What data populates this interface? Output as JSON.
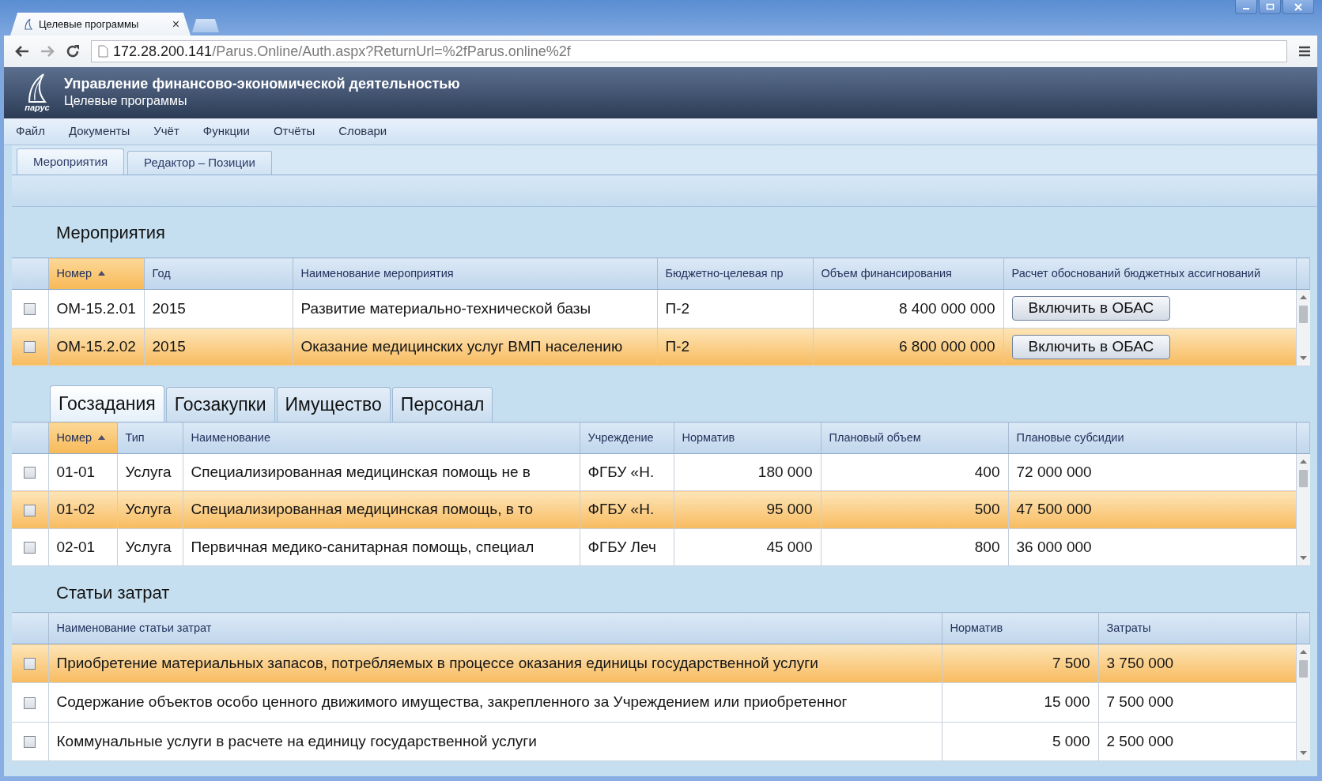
{
  "browser": {
    "tab_title": "Целевые программы",
    "tab_close": "×",
    "url_host": "172.28.200.141",
    "url_path": "/Parus.Online/Auth.aspx?ReturnUrl=%2fParus.online%2f"
  },
  "app": {
    "logo_text": "парус",
    "title": "Управление финансово-экономической деятельностью",
    "subtitle": "Целевые программы"
  },
  "menu": [
    "Файл",
    "Документы",
    "Учёт",
    "Функции",
    "Отчёты",
    "Словари"
  ],
  "tabs": [
    {
      "label": "Мероприятия",
      "selected": true
    },
    {
      "label": "Редактор – Позиции",
      "selected": false
    }
  ],
  "events": {
    "title": "Мероприятия",
    "columns": [
      {
        "label": "Номер",
        "sorted": true
      },
      {
        "label": "Год",
        "sorted": false
      },
      {
        "label": "Наименование мероприятия",
        "sorted": false
      },
      {
        "label": "Бюджетно-целевая пр",
        "sorted": false
      },
      {
        "label": "Объем финансирования",
        "sorted": false
      },
      {
        "label": "Расчет обоснований бюджетных ассигнований",
        "sorted": false
      }
    ],
    "rows": [
      {
        "selected": false,
        "checked": false,
        "cells": [
          "ОМ-15.2.01",
          "2015",
          "Развитие материально-технической базы",
          "П-2",
          "8 400 000 000"
        ],
        "button": "Включить в ОБАС"
      },
      {
        "selected": true,
        "checked": false,
        "cells": [
          "ОМ-15.2.02",
          "2015",
          "Оказание медицинских услуг ВМП населению",
          "П-2",
          "6 800 000 000"
        ],
        "button": "Включить в ОБАС"
      }
    ]
  },
  "detail_tabs": [
    {
      "label": "Госзадания",
      "selected": true
    },
    {
      "label": "Госзакупки",
      "selected": false
    },
    {
      "label": "Имущество",
      "selected": false
    },
    {
      "label": "Персонал",
      "selected": false
    }
  ],
  "tasks": {
    "columns": [
      {
        "label": "Номер",
        "sorted": true
      },
      {
        "label": "Тип",
        "sorted": false
      },
      {
        "label": "Наименование",
        "sorted": false
      },
      {
        "label": "Учреждение",
        "sorted": false
      },
      {
        "label": "Норматив",
        "sorted": false
      },
      {
        "label": "Плановый объем",
        "sorted": false
      },
      {
        "label": "Плановые субсидии",
        "sorted": false
      }
    ],
    "rows": [
      {
        "selected": false,
        "checked": false,
        "cells": [
          "01-01",
          "Услуга",
          "Специализированная медицинская помощь не в",
          "ФГБУ «Н.",
          "180 000",
          "400",
          "72 000 000"
        ]
      },
      {
        "selected": true,
        "checked": false,
        "cells": [
          "01-02",
          "Услуга",
          "Специализированная медицинская помощь, в то",
          "ФГБУ «Н.",
          "95 000",
          "500",
          "47 500 000"
        ]
      },
      {
        "selected": false,
        "checked": false,
        "cells": [
          "02-01",
          "Услуга",
          "Первичная медико-санитарная помощь, специал",
          "ФГБУ Леч",
          "45 000",
          "800",
          "36 000 000"
        ]
      }
    ]
  },
  "costs": {
    "title": "Статьи затрат",
    "columns": [
      {
        "label": "Наименование статьи затрат",
        "sorted": false
      },
      {
        "label": "Норматив",
        "sorted": false
      },
      {
        "label": "Затраты",
        "sorted": false
      }
    ],
    "rows": [
      {
        "selected": true,
        "checked": false,
        "cells": [
          "Приобретение материальных запасов, потребляемых в процессе оказания единицы государственной услуги",
          "7 500",
          "3 750 000"
        ]
      },
      {
        "selected": false,
        "checked": false,
        "cells": [
          "Содержание объектов особо ценного движимого имущества, закрепленного за Учреждением или приобретенног",
          "15 000",
          "7 500 000"
        ]
      },
      {
        "selected": false,
        "checked": false,
        "cells": [
          "Коммунальные услуги в расчете на единицу государственной услуги",
          "5 000",
          "2 500 000"
        ]
      }
    ]
  }
}
